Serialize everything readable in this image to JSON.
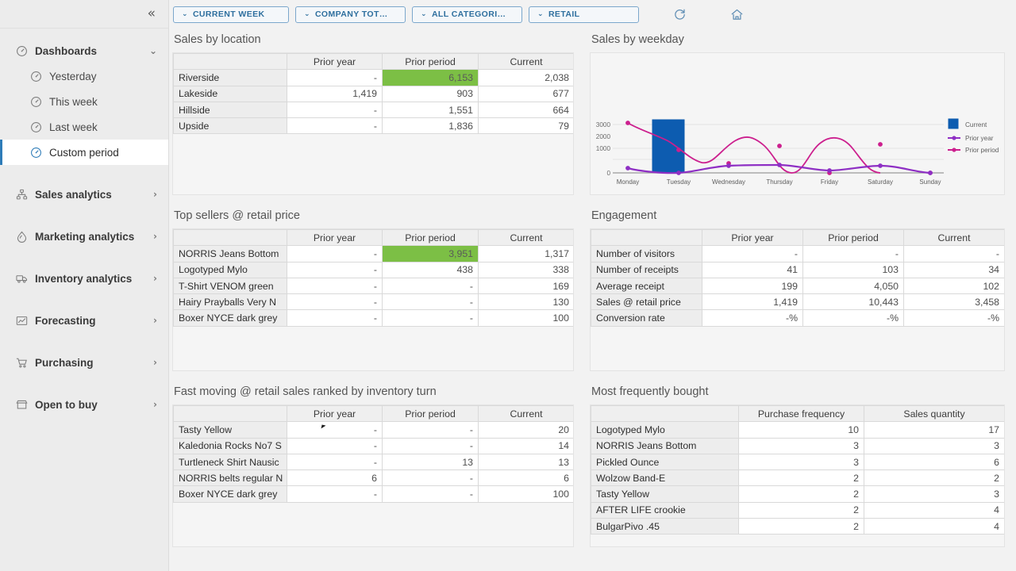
{
  "sidebar": {
    "collapse_icon": "«",
    "groups": [
      {
        "label": "Dashboards",
        "icon": "gauge-icon",
        "expanded_caret": "⌄",
        "children": [
          {
            "label": "Yesterday",
            "icon": "gauge-icon",
            "active": false
          },
          {
            "label": "This week",
            "icon": "gauge-icon",
            "active": false
          },
          {
            "label": "Last week",
            "icon": "gauge-icon",
            "active": false
          },
          {
            "label": "Custom period",
            "icon": "gauge-icon",
            "active": true
          }
        ]
      }
    ],
    "items": [
      {
        "label": "Sales analytics",
        "icon": "org-chart-icon",
        "caret": "›"
      },
      {
        "label": "Marketing analytics",
        "icon": "megaphone-icon",
        "caret": "›"
      },
      {
        "label": "Inventory analytics",
        "icon": "truck-icon",
        "caret": "›"
      },
      {
        "label": "Forecasting",
        "icon": "trend-chart-icon",
        "caret": "›"
      },
      {
        "label": "Purchasing",
        "icon": "shopping-cart-icon",
        "caret": "›"
      },
      {
        "label": "Open to buy",
        "icon": "storefront-icon",
        "caret": "›"
      }
    ]
  },
  "filterbar": {
    "caret": "⌄",
    "chips": [
      {
        "label": "CURRENT WEEK",
        "name": "filter-period"
      },
      {
        "label": "COMPANY TOT…",
        "name": "filter-company"
      },
      {
        "label": "ALL CATEGORI…",
        "name": "filter-category"
      },
      {
        "label": "RETAIL",
        "name": "filter-channel"
      }
    ],
    "refresh_icon": "refresh-icon",
    "home_icon": "home-icon"
  },
  "widgets": {
    "sales_by_location": {
      "title": "Sales by location",
      "columns": [
        "",
        "Prior year",
        "Prior period",
        "Current"
      ],
      "rows": [
        {
          "label": "Riverside",
          "values": [
            "-",
            "6,153",
            "2,038"
          ],
          "highlight": 1
        },
        {
          "label": "Lakeside",
          "values": [
            "1,419",
            "903",
            "677"
          ],
          "highlight": -1
        },
        {
          "label": "Hillside",
          "values": [
            "-",
            "1,551",
            "664"
          ],
          "highlight": -1
        },
        {
          "label": "Upside",
          "values": [
            "-",
            "1,836",
            "79"
          ],
          "highlight": -1
        }
      ]
    },
    "top_sellers": {
      "title": "Top sellers @ retail price",
      "columns": [
        "",
        "Prior year",
        "Prior period",
        "Current"
      ],
      "rows": [
        {
          "label": "NORRIS Jeans Bottom",
          "values": [
            "-",
            "3,951",
            "1,317"
          ],
          "highlight": 1
        },
        {
          "label": "Logotyped Mylo",
          "values": [
            "-",
            "438",
            "338"
          ],
          "highlight": -1
        },
        {
          "label": "T-Shirt VENOM green",
          "values": [
            "-",
            "-",
            "169"
          ],
          "highlight": -1
        },
        {
          "label": "Hairy Prayballs Very N",
          "values": [
            "-",
            "-",
            "130"
          ],
          "highlight": -1
        },
        {
          "label": "Boxer NYCE dark grey",
          "values": [
            "-",
            "-",
            "100"
          ],
          "highlight": -1
        }
      ]
    },
    "fast_moving": {
      "title": "Fast moving @ retail sales ranked by inventory turn",
      "columns": [
        "",
        "Prior year",
        "Prior period",
        "Current"
      ],
      "rows": [
        {
          "label": "Tasty Yellow",
          "values": [
            "-",
            "-",
            "20"
          ],
          "highlight": -1
        },
        {
          "label": "Kaledonia Rocks No7 S",
          "values": [
            "-",
            "-",
            "14"
          ],
          "highlight": -1
        },
        {
          "label": "Turtleneck Shirt Nausic",
          "values": [
            "-",
            "13",
            "13"
          ],
          "highlight": -1
        },
        {
          "label": "NORRIS belts regular N",
          "values": [
            "6",
            "-",
            "6"
          ],
          "highlight": -1
        },
        {
          "label": "Boxer NYCE dark grey",
          "values": [
            "-",
            "-",
            "100"
          ],
          "highlight": -1
        }
      ]
    },
    "engagement": {
      "title": "Engagement",
      "columns": [
        "",
        "Prior year",
        "Prior period",
        "Current"
      ],
      "rows": [
        {
          "label": "Number of visitors",
          "values": [
            "-",
            "-",
            "-"
          ],
          "highlight": -1
        },
        {
          "label": "Number of receipts",
          "values": [
            "41",
            "103",
            "34"
          ],
          "highlight": -1
        },
        {
          "label": "Average receipt",
          "values": [
            "199",
            "4,050",
            "102"
          ],
          "highlight": -1
        },
        {
          "label": "Sales @ retail price",
          "values": [
            "1,419",
            "10,443",
            "3,458"
          ],
          "highlight": -1
        },
        {
          "label": "Conversion rate",
          "values": [
            "-%",
            "-%",
            "-%"
          ],
          "highlight": -1
        }
      ]
    },
    "most_frequently_bought": {
      "title": "Most frequently bought",
      "columns": [
        "",
        "Purchase frequency",
        "Sales quantity"
      ],
      "rows": [
        {
          "label": "Logotyped Mylo",
          "values": [
            "10",
            "17"
          ]
        },
        {
          "label": "NORRIS Jeans Bottom",
          "values": [
            "3",
            "3"
          ]
        },
        {
          "label": "Pickled Ounce",
          "values": [
            "3",
            "6"
          ]
        },
        {
          "label": "Wolzow Band-E",
          "values": [
            "2",
            "2"
          ]
        },
        {
          "label": "Tasty Yellow",
          "values": [
            "2",
            "3"
          ]
        },
        {
          "label": "AFTER LIFE crookie",
          "values": [
            "2",
            "4"
          ]
        },
        {
          "label": "BulgarPivo .45",
          "values": [
            "2",
            "4"
          ]
        }
      ]
    },
    "sales_by_weekday": {
      "title": "Sales by weekday"
    }
  },
  "chart_data": {
    "type": "line",
    "title": "Sales by weekday",
    "xlabel": "",
    "ylabel": "",
    "categories": [
      "Monday",
      "Tuesday",
      "Wednesday",
      "Thursday",
      "Friday",
      "Saturday",
      "Sunday"
    ],
    "yticks": [
      0,
      1000,
      2000,
      3000
    ],
    "ylim": [
      0,
      3600
    ],
    "grid": true,
    "legend_position": "right",
    "series": [
      {
        "name": "Current",
        "type": "bar",
        "color": "#0d5cb0",
        "values": [
          0,
          3380,
          0,
          0,
          0,
          0,
          0
        ]
      },
      {
        "name": "Prior year",
        "type": "line",
        "color": "#8e2fc4",
        "values": [
          195,
          10,
          330,
          370,
          170,
          320,
          5
        ]
      },
      {
        "name": "Prior period",
        "type": "line",
        "color": "#cc1f8e",
        "values": [
          3150,
          1930,
          760,
          2250,
          10,
          2360,
          5
        ]
      }
    ],
    "legend": [
      {
        "label": "Current",
        "marker": "square",
        "color": "#0d5cb0"
      },
      {
        "label": "Prior year",
        "marker": "line-dot",
        "color": "#8e2fc4"
      },
      {
        "label": "Prior period",
        "marker": "line-dot",
        "color": "#cc1f8e"
      }
    ]
  },
  "colors": {
    "accent_blue": "#2e7cb8",
    "highlight_green": "#7cbf45",
    "bar_blue": "#0d5cb0",
    "prior_year_purple": "#8e2fc4",
    "prior_period_magenta": "#cc1f8e"
  }
}
